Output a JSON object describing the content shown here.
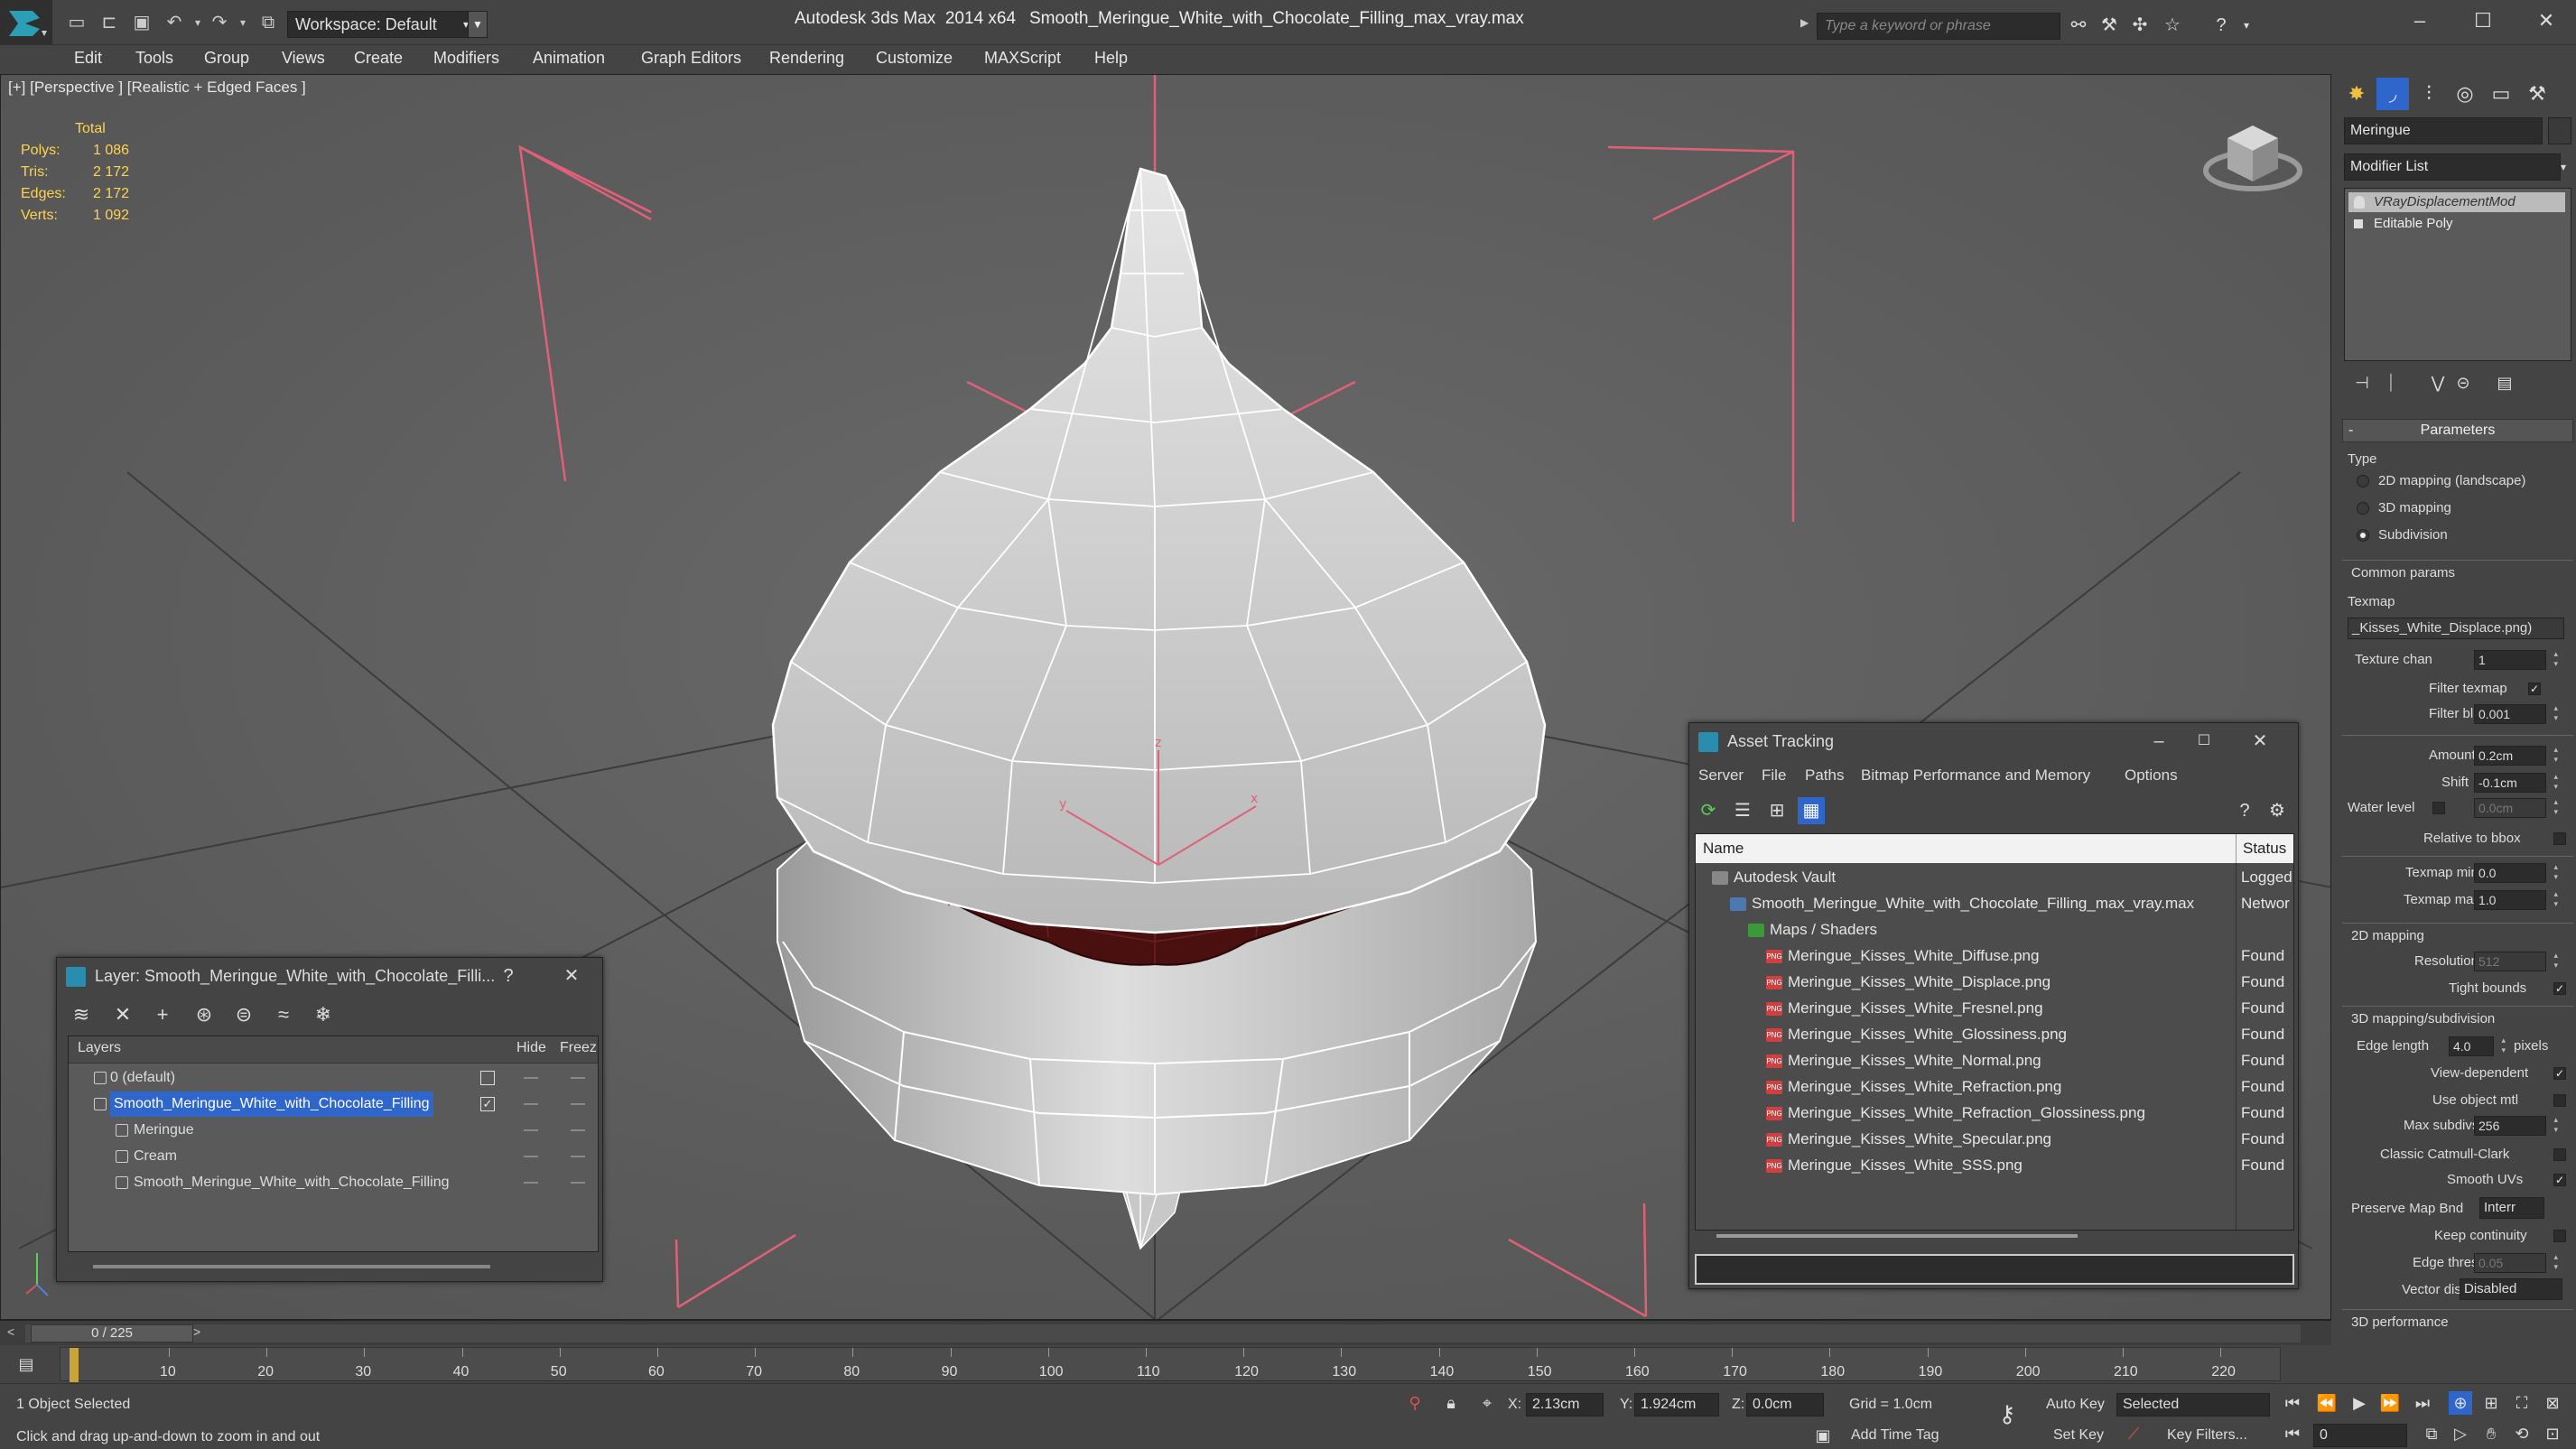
{
  "window": {
    "app_title": "Autodesk 3ds Max  2014 x64",
    "file_title": "Smooth_Meringue_White_with_Chocolate_Filling_max_vray.max",
    "workspace": "Workspace: Default",
    "search_placeholder": "Type a keyword or phrase"
  },
  "menu": [
    "Edit",
    "Tools",
    "Group",
    "Views",
    "Create",
    "Modifiers",
    "Animation",
    "Graph Editors",
    "Rendering",
    "Customize",
    "MAXScript",
    "Help"
  ],
  "viewport": {
    "label": "[+] [Perspective ] [Realistic + Edged Faces ]",
    "stats": {
      "total_label": "Total",
      "rows": [
        {
          "label": "Polys:",
          "value": "1 086"
        },
        {
          "label": "Tris:",
          "value": "2 172"
        },
        {
          "label": "Edges:",
          "value": "2 172"
        },
        {
          "label": "Verts:",
          "value": "1 092"
        }
      ]
    },
    "axis_labels": {
      "x": "x",
      "y": "y",
      "z": "z"
    }
  },
  "layer_dialog": {
    "title": "Layer: Smooth_Meringue_White_with_Chocolate_Filli...",
    "help": "?",
    "columns": {
      "layers": "Layers",
      "hide": "Hide",
      "freeze": "Freez"
    },
    "rows": [
      {
        "name": "0 (default)",
        "indent": 0,
        "selected": false
      },
      {
        "name": "Smooth_Meringue_White_with_Chocolate_Filling",
        "indent": 0,
        "selected": true
      },
      {
        "name": "Meringue",
        "indent": 1,
        "selected": false
      },
      {
        "name": "Cream",
        "indent": 1,
        "selected": false
      },
      {
        "name": "Smooth_Meringue_White_with_Chocolate_Filling",
        "indent": 1,
        "selected": false
      }
    ]
  },
  "asset_dialog": {
    "title": "Asset Tracking",
    "menu": [
      "Server",
      "File",
      "Paths",
      "Bitmap Performance and Memory",
      "Options"
    ],
    "columns": {
      "name": "Name",
      "status": "Status"
    },
    "rows": [
      {
        "name": "Autodesk Vault",
        "status": "Logged",
        "level": 0,
        "icon": "vault-icon"
      },
      {
        "name": "Smooth_Meringue_White_with_Chocolate_Filling_max_vray.max",
        "status": "Networ",
        "level": 1,
        "icon": "max-file-icon"
      },
      {
        "name": "Maps / Shaders",
        "status": "",
        "level": 2,
        "icon": "maps-icon"
      },
      {
        "name": "Meringue_Kisses_White_Diffuse.png",
        "status": "Found",
        "level": 3,
        "icon": "png-icon"
      },
      {
        "name": "Meringue_Kisses_White_Displace.png",
        "status": "Found",
        "level": 3,
        "icon": "png-icon"
      },
      {
        "name": "Meringue_Kisses_White_Fresnel.png",
        "status": "Found",
        "level": 3,
        "icon": "png-icon"
      },
      {
        "name": "Meringue_Kisses_White_Glossiness.png",
        "status": "Found",
        "level": 3,
        "icon": "png-icon"
      },
      {
        "name": "Meringue_Kisses_White_Normal.png",
        "status": "Found",
        "level": 3,
        "icon": "png-icon"
      },
      {
        "name": "Meringue_Kisses_White_Refraction.png",
        "status": "Found",
        "level": 3,
        "icon": "png-icon"
      },
      {
        "name": "Meringue_Kisses_White_Refraction_Glossiness.png",
        "status": "Found",
        "level": 3,
        "icon": "png-icon"
      },
      {
        "name": "Meringue_Kisses_White_Specular.png",
        "status": "Found",
        "level": 3,
        "icon": "png-icon"
      },
      {
        "name": "Meringue_Kisses_White_SSS.png",
        "status": "Found",
        "level": 3,
        "icon": "png-icon"
      }
    ],
    "png_badge": "PNG"
  },
  "command_panel": {
    "object_name": "Meringue",
    "modifier_list": "Modifier List",
    "stack": [
      {
        "name": "VRayDisplacementMod",
        "active": true
      },
      {
        "name": "Editable Poly",
        "active": false
      }
    ],
    "parameters": {
      "header": "Parameters",
      "type_label": "Type",
      "type_options": [
        {
          "label": "2D mapping (landscape)",
          "on": false
        },
        {
          "label": "3D mapping",
          "on": false
        },
        {
          "label": "Subdivision",
          "on": true
        }
      ],
      "common_params": "Common params",
      "texmap_label": "Texmap",
      "texmap_value": "_Kisses_White_Displace.png)",
      "texture_chan_label": "Texture chan",
      "texture_chan_value": "1",
      "filter_texmap_label": "Filter texmap",
      "filter_blur_label": "Filter blur",
      "filter_blur_value": "0.001",
      "amount_label": "Amount",
      "amount_value": "0.2cm",
      "shift_label": "Shift",
      "shift_value": "-0.1cm",
      "water_level_label": "Water level",
      "water_level_value": "0.0cm",
      "relative_bbox_label": "Relative to bbox",
      "texmap_min_label": "Texmap min",
      "texmap_min_value": "0.0",
      "texmap_max_label": "Texmap max",
      "texmap_max_value": "1.0",
      "mapping_2d": "2D mapping",
      "resolution_label": "Resolution",
      "resolution_value": "512",
      "tight_bounds_label": "Tight bounds",
      "mapping_3d": "3D mapping/subdivision",
      "edge_length_label": "Edge length",
      "edge_length_value": "4.0",
      "pixels_label": "pixels",
      "view_dependent_label": "View-dependent",
      "use_object_mtl_label": "Use object mtl",
      "max_subdivs_label": "Max subdivs",
      "max_subdivs_value": "256",
      "catmull_label": "Classic Catmull-Clark",
      "smooth_uvs_label": "Smooth UVs",
      "preserve_label": "Preserve Map Bnd",
      "preserve_value": "Interr",
      "keep_continuity_label": "Keep continuity",
      "edge_thresh_label": "Edge thresh",
      "edge_thresh_value": "0.05",
      "vector_disp_label": "Vector displ",
      "vector_disp_value": "Disabled",
      "perf_header": "3D performance"
    }
  },
  "timeline": {
    "slider": "0 / 225",
    "ticks": [
      "10",
      "20",
      "30",
      "40",
      "50",
      "60",
      "70",
      "80",
      "90",
      "100",
      "110",
      "120",
      "130",
      "140",
      "150",
      "160",
      "170",
      "180",
      "190",
      "200",
      "210",
      "220"
    ]
  },
  "status": {
    "selection": "1 Object Selected",
    "prompt": "Click and drag up-and-down to zoom in and out",
    "x_label": "X:",
    "x_value": "2.13cm",
    "y_label": "Y:",
    "y_value": "1.924cm",
    "z_label": "Z:",
    "z_value": "0.0cm",
    "grid": "Grid = 1.0cm",
    "add_time_tag": "Add Time Tag",
    "auto_key": "Auto Key",
    "selected": "Selected",
    "set_key": "Set Key",
    "key_filters": "Key Filters...",
    "frame": "0"
  },
  "colors": {
    "selection_blue": "#2e66cc",
    "stats_yellow": "#ffd34e",
    "gizmo_pink": "#e0607a",
    "chocolate": "#4a1010",
    "meringue_white": "#d8d8d8"
  }
}
